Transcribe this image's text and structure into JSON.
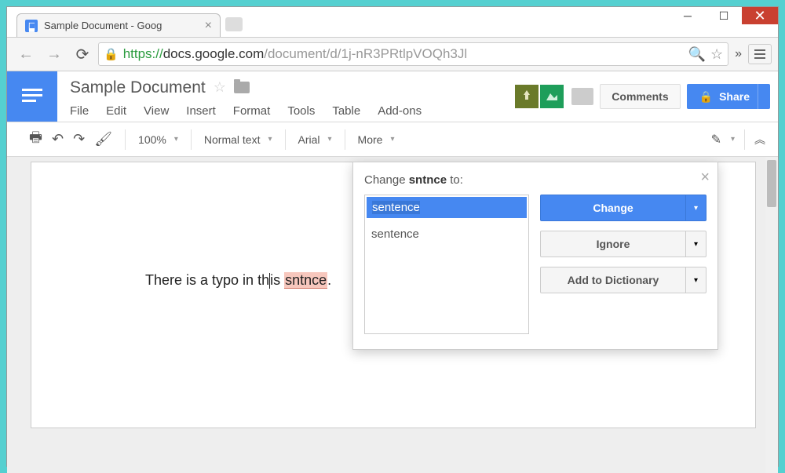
{
  "window": {
    "tab_title": "Sample Document - Goog",
    "url_protocol": "https://",
    "url_host": "docs.google.com",
    "url_path": "/document/d/1j-nR3PRtlpVOQh3Jl"
  },
  "docs": {
    "title": "Sample Document",
    "menus": [
      "File",
      "Edit",
      "View",
      "Insert",
      "Format",
      "Tools",
      "Table",
      "Add-ons"
    ],
    "comments_label": "Comments",
    "share_label": "Share"
  },
  "toolbar": {
    "zoom": "100%",
    "style": "Normal text",
    "font": "Arial",
    "more_label": "More"
  },
  "document": {
    "text_before": "There is a typo in th",
    "text_mid": "is ",
    "typo_word": "sntnce",
    "text_after": "."
  },
  "spellcheck": {
    "prompt_prefix": "Change ",
    "prompt_word": "sntnce",
    "prompt_suffix": " to:",
    "input_value": "sentence",
    "suggestions": [
      "sentence"
    ],
    "change_label": "Change",
    "ignore_label": "Ignore",
    "add_label": "Add to Dictionary"
  }
}
